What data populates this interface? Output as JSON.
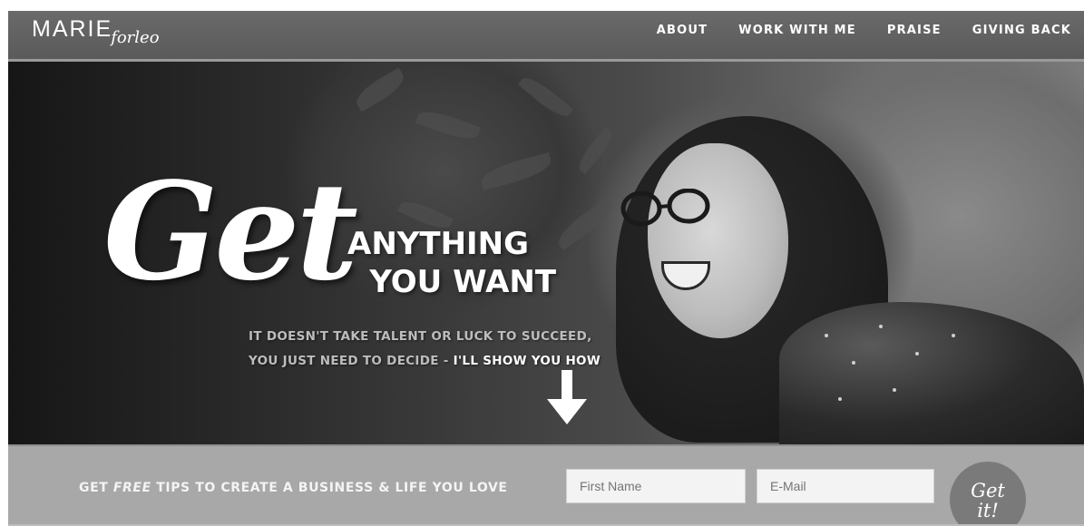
{
  "header": {
    "logo_main": "MARIE",
    "logo_script": "forleo",
    "nav": [
      {
        "label": "ABOUT"
      },
      {
        "label": "WORK WITH ME"
      },
      {
        "label": "PRAISE"
      },
      {
        "label": "GIVING BACK"
      }
    ]
  },
  "hero": {
    "script_word": "Get",
    "heading_line1": "ANYTHING",
    "heading_line2": "YOU WANT",
    "sub_line1": "IT DOESN'T TAKE TALENT OR LUCK TO SUCCEED,",
    "sub_line2_part1": "YOU JUST NEED TO DECIDE - ",
    "sub_line2_part2": "I'LL SHOW YOU HOW",
    "arrow_icon": "down-arrow-icon"
  },
  "signup": {
    "text_before": "GET ",
    "text_emphasis": "FREE",
    "text_after": " TIPS TO CREATE A BUSINESS & LIFE YOU LOVE",
    "first_name_placeholder": "First Name",
    "email_placeholder": "E-Mail",
    "button_line1": "Get",
    "button_line2": "it!"
  },
  "colors": {
    "header_bg": "#5f5f5f",
    "signup_bg": "#a8a8a8",
    "button_bg": "#7a7a7a"
  }
}
